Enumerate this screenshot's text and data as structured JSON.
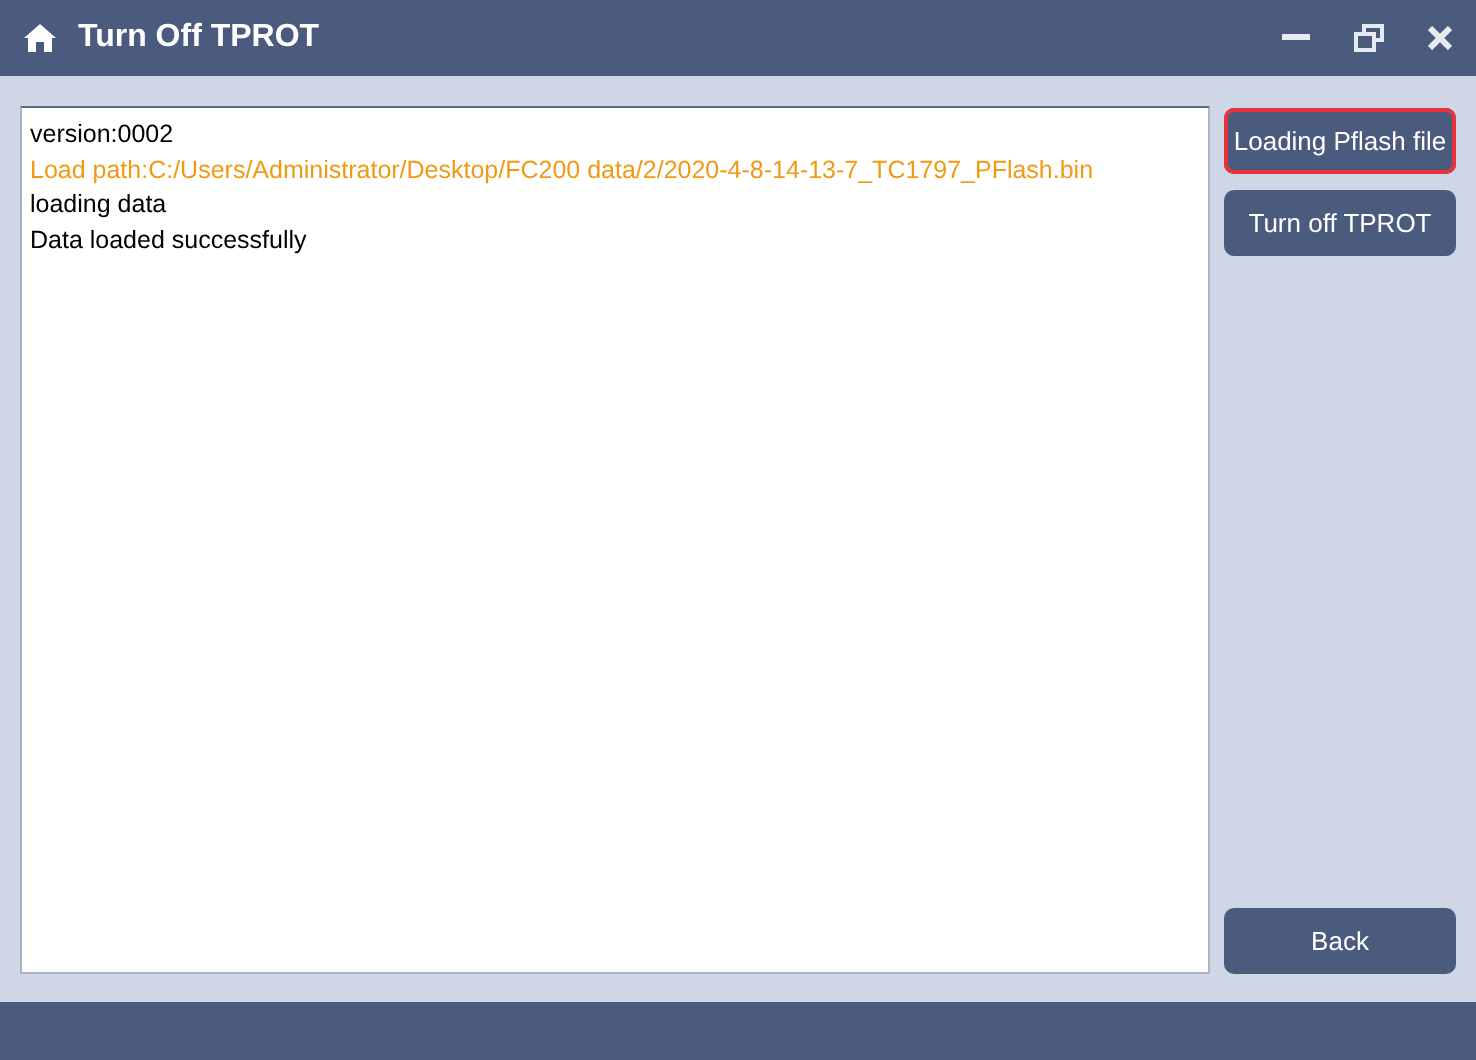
{
  "window": {
    "title": "Turn Off TPROT"
  },
  "log": [
    {
      "kind": "info",
      "text": "version:0002"
    },
    {
      "kind": "path",
      "text": "Load path:C:/Users/Administrator/Desktop/FC200 data/2/2020-4-8-14-13-7_TC1797_PFlash.bin"
    },
    {
      "kind": "info",
      "text": "loading data"
    },
    {
      "kind": "info",
      "text": "Data loaded successfully"
    }
  ],
  "buttons": [
    {
      "label": "Loading Pflash file",
      "focused": true
    },
    {
      "label": "Turn off TPROT",
      "focused": false
    }
  ],
  "back_button": {
    "label": "Back"
  }
}
